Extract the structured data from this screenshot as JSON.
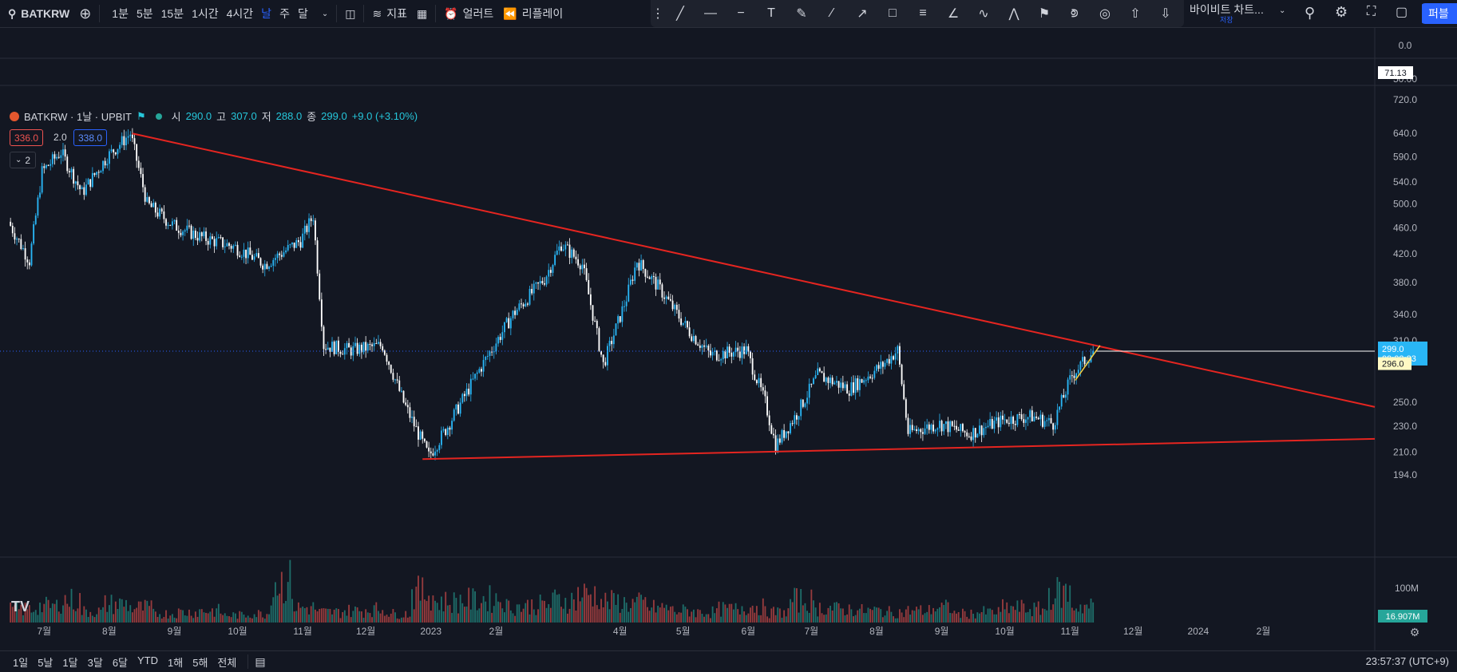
{
  "topbar": {
    "symbol": "BATKRW",
    "intervals": [
      "1분",
      "5분",
      "15분",
      "1시간",
      "4시간",
      "날",
      "주",
      "달"
    ],
    "active_interval": "날",
    "indicators_label": "지표",
    "alert_label": "얼러트",
    "replay_label": "리플레이",
    "layout_title": "바이비트 차트...",
    "save_label": "저장",
    "publish_label": "퍼블"
  },
  "legend": {
    "title": "BATKRW · 1날 · UPBIT",
    "open_label": "시",
    "open": "290.0",
    "high_label": "고",
    "high": "307.0",
    "low_label": "저",
    "low": "288.0",
    "close_label": "종",
    "close": "299.0",
    "change": "+9.0 (+3.10%)",
    "bid": "336.0",
    "spread": "2.0",
    "ask": "338.0",
    "collapse": "2"
  },
  "price_axis": {
    "labels": [
      "720.0",
      "640.0",
      "590.0",
      "540.0",
      "500.0",
      "460.0",
      "420.0",
      "380.0",
      "340.0",
      "310.0",
      "250.0",
      "230.0",
      "210.0",
      "194.0"
    ],
    "current_price": "299.0",
    "countdown": "09:02:23",
    "marker_price": "296.0",
    "volume_label": "100M",
    "current_volume": "16.907M",
    "osc_zero": "0.0",
    "rsi_value": "71.13",
    "rsi_mid": "50.00"
  },
  "time_axis": [
    "7월",
    "8월",
    "9월",
    "10월",
    "11월",
    "12월",
    "2023",
    "2월",
    "4월",
    "5월",
    "6월",
    "7월",
    "8월",
    "9월",
    "10월",
    "11월",
    "12월",
    "2024",
    "2월"
  ],
  "bottombar": {
    "ranges": [
      "1일",
      "5날",
      "1달",
      "3달",
      "6달",
      "YTD",
      "1해",
      "5해",
      "전체"
    ],
    "clock": "23:57:37 (UTC+9)"
  },
  "colors": {
    "background": "#131722",
    "up": "#26a69a",
    "down": "#ef5350",
    "candle_up": "#29b6f6",
    "candle_down": "#ffffff",
    "trendline": "#e52520",
    "accent": "#2962ff"
  },
  "chart_data": {
    "type": "candlestick",
    "scale": "log",
    "ylim": [
      194,
      720
    ],
    "series": [
      {
        "name": "BATKRW",
        "points": [
          [
            "2022-06-15",
            470
          ],
          [
            "2022-06-25",
            410
          ],
          [
            "2022-07-01",
            560
          ],
          [
            "2022-07-10",
            600
          ],
          [
            "2022-07-20",
            520
          ],
          [
            "2022-08-01",
            590
          ],
          [
            "2022-08-12",
            640
          ],
          [
            "2022-08-20",
            500
          ],
          [
            "2022-09-01",
            465
          ],
          [
            "2022-09-15",
            445
          ],
          [
            "2022-10-01",
            430
          ],
          [
            "2022-10-15",
            405
          ],
          [
            "2022-11-01",
            440
          ],
          [
            "2022-11-07",
            480
          ],
          [
            "2022-11-12",
            305
          ],
          [
            "2022-11-25",
            300
          ],
          [
            "2022-12-10",
            305
          ],
          [
            "2022-12-20",
            250
          ],
          [
            "2023-01-01",
            207
          ],
          [
            "2023-01-10",
            230
          ],
          [
            "2023-01-25",
            280
          ],
          [
            "2023-02-10",
            340
          ],
          [
            "2023-02-25",
            385
          ],
          [
            "2023-03-05",
            435
          ],
          [
            "2023-03-15",
            405
          ],
          [
            "2023-03-25",
            285
          ],
          [
            "2023-04-05",
            360
          ],
          [
            "2023-04-10",
            410
          ],
          [
            "2023-04-20",
            375
          ],
          [
            "2023-05-05",
            320
          ],
          [
            "2023-05-15",
            295
          ],
          [
            "2023-06-01",
            300
          ],
          [
            "2023-06-10",
            250
          ],
          [
            "2023-06-15",
            215
          ],
          [
            "2023-06-25",
            240
          ],
          [
            "2023-07-05",
            275
          ],
          [
            "2023-07-20",
            262
          ],
          [
            "2023-08-05",
            285
          ],
          [
            "2023-08-12",
            300
          ],
          [
            "2023-08-17",
            225
          ],
          [
            "2023-09-01",
            232
          ],
          [
            "2023-09-15",
            224
          ],
          [
            "2023-10-01",
            235
          ],
          [
            "2023-10-15",
            238
          ],
          [
            "2023-10-25",
            232
          ],
          [
            "2023-11-03",
            275
          ],
          [
            "2023-11-13",
            299
          ]
        ]
      }
    ],
    "trendlines": [
      {
        "from": [
          "2022-08-12",
          640
        ],
        "to": [
          "2024-03-25",
          246
        ]
      },
      {
        "from": [
          "2022-12-28",
          205
        ],
        "to": [
          "2024-03-25",
          220
        ]
      }
    ],
    "volume": [
      18,
      22,
      30,
      15,
      25,
      20,
      12,
      14,
      16,
      10,
      12,
      55,
      20,
      14,
      16,
      18,
      12,
      40,
      28,
      30,
      32,
      22,
      24,
      30,
      38,
      28,
      26,
      20,
      16,
      14,
      18,
      22,
      14,
      30,
      20,
      18,
      16,
      14,
      16,
      20,
      12,
      14,
      20,
      18,
      40,
      22
    ]
  }
}
